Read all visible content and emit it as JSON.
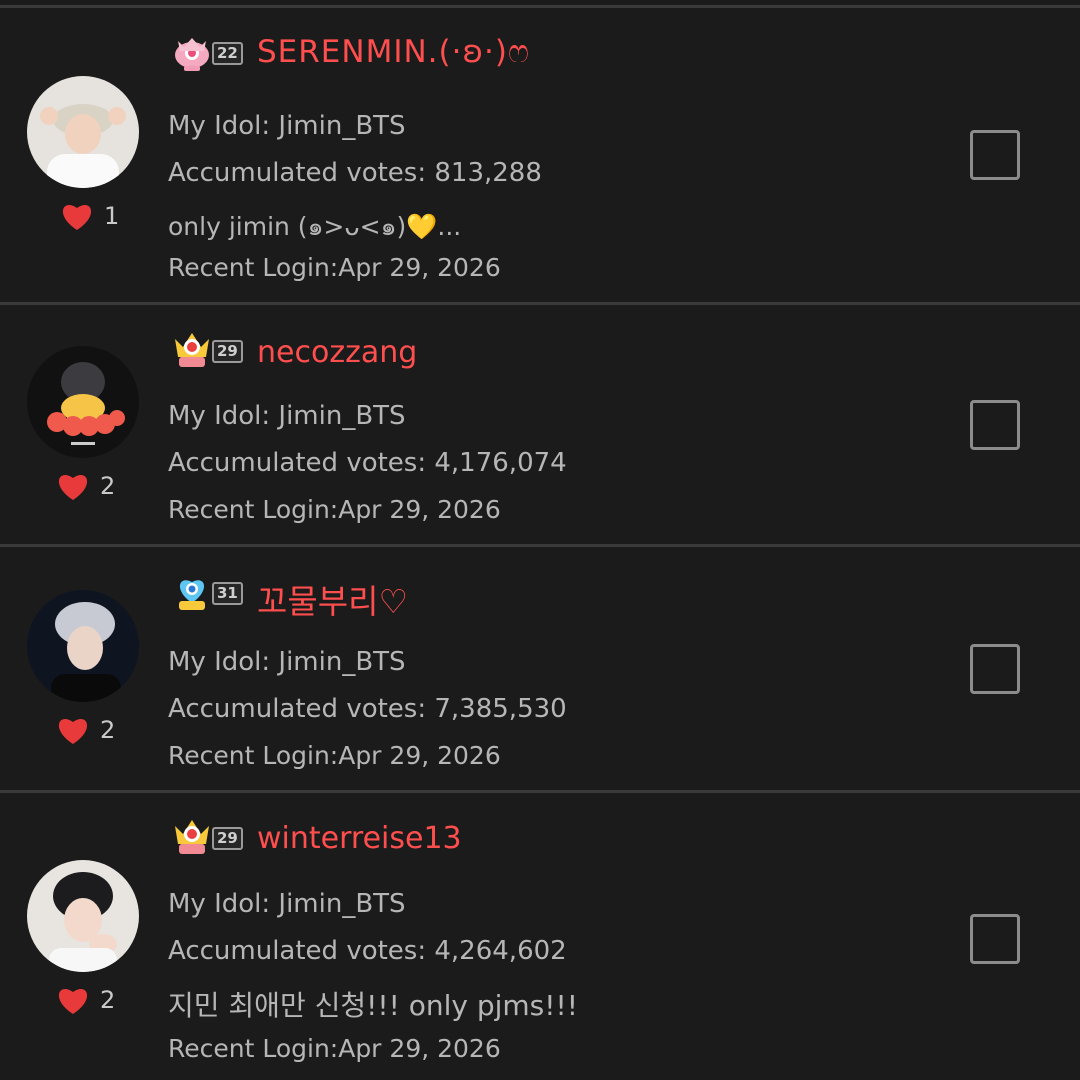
{
  "colors": {
    "background": "#1b1b1b",
    "nickname": "#ff4e4e",
    "heart": "#e83a3a",
    "text": "#b6b6b6"
  },
  "entries": [
    {
      "level": "22",
      "nickname": "SERENMIN.(·ʚ·)ෆ",
      "idol": "My Idol: Jimin_BTS",
      "votes": "Accumulated votes: 813,288",
      "message": "only jimin (๑>ᴗ<๑)💛...",
      "login": "Recent Login:Apr 29, 2026",
      "likes": "1",
      "emblem": "pink-crown-emblem-icon"
    },
    {
      "level": "29",
      "nickname": "necozzang",
      "idol": "My Idol: Jimin_BTS",
      "votes": "Accumulated votes: 4,176,074",
      "login": "Recent Login:Apr 29, 2026",
      "likes": "2",
      "emblem": "gold-crown-emblem-icon"
    },
    {
      "level": "31",
      "nickname": "꼬물부리♡",
      "idol": "My Idol: Jimin_BTS",
      "votes": "Accumulated votes: 7,385,530",
      "login": "Recent Login:Apr 29, 2026",
      "likes": "2",
      "emblem": "blue-heart-emblem-icon"
    },
    {
      "level": "29",
      "nickname": "winterreise13",
      "idol": "My Idol: Jimin_BTS",
      "votes": "Accumulated votes: 4,264,602",
      "message": "지민 최애만 신청!!! only pjms!!!",
      "login": "Recent Login:Apr 29, 2026",
      "likes": "2",
      "emblem": "gold-crown-emblem-icon"
    }
  ]
}
